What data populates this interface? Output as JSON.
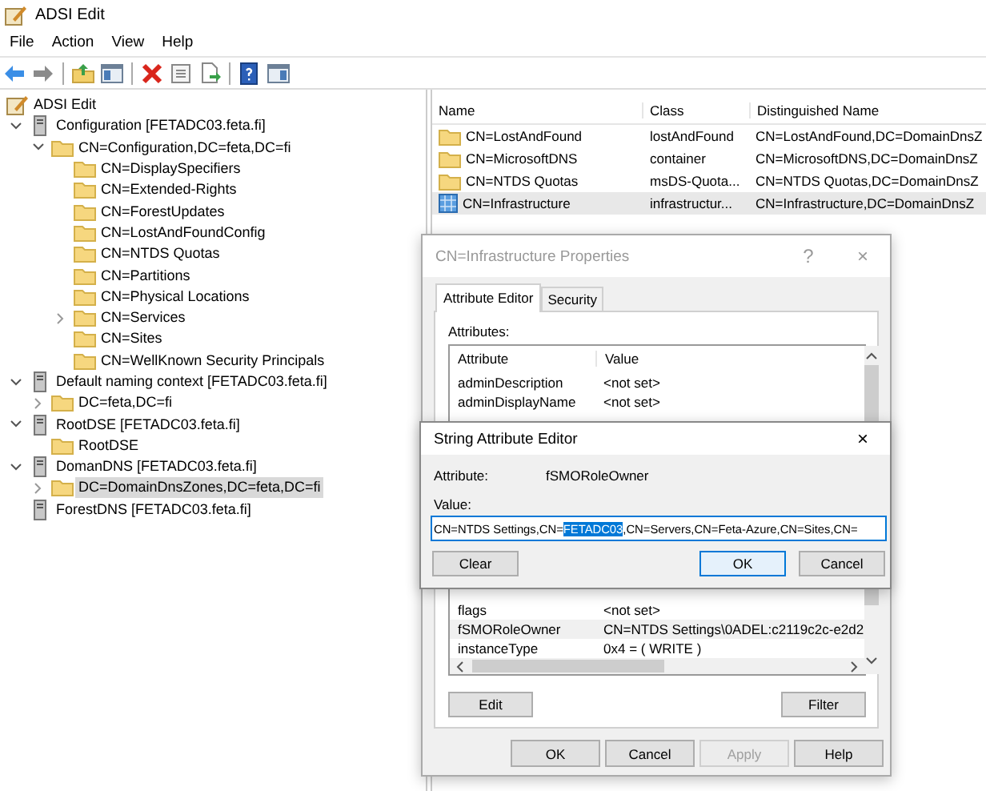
{
  "window": {
    "title": "ADSI Edit"
  },
  "menu": [
    "File",
    "Action",
    "View",
    "Help"
  ],
  "tree": [
    {
      "label": "ADSI Edit",
      "kind": "app",
      "selected": false,
      "children": [
        {
          "label": "Configuration [FETADC03.feta.fi]",
          "kind": "server",
          "expanded": true,
          "selected": false,
          "children": [
            {
              "label": "CN=Configuration,DC=feta,DC=fi",
              "kind": "folder",
              "expanded": true,
              "selected": false,
              "children": [
                {
                  "label": "CN=DisplaySpecifiers",
                  "kind": "folder",
                  "selected": false
                },
                {
                  "label": "CN=Extended-Rights",
                  "kind": "folder",
                  "selected": false
                },
                {
                  "label": "CN=ForestUpdates",
                  "kind": "folder",
                  "selected": false
                },
                {
                  "label": "CN=LostAndFoundConfig",
                  "kind": "folder",
                  "selected": false
                },
                {
                  "label": "CN=NTDS Quotas",
                  "kind": "folder",
                  "selected": false
                },
                {
                  "label": "CN=Partitions",
                  "kind": "folder",
                  "selected": false
                },
                {
                  "label": "CN=Physical Locations",
                  "kind": "folder",
                  "selected": false
                },
                {
                  "label": "CN=Services",
                  "kind": "folder",
                  "expanded": false,
                  "selected": false
                },
                {
                  "label": "CN=Sites",
                  "kind": "folder",
                  "selected": false
                },
                {
                  "label": "CN=WellKnown Security Principals",
                  "kind": "folder",
                  "selected": false
                }
              ]
            }
          ]
        },
        {
          "label": "Default naming context [FETADC03.feta.fi]",
          "kind": "server",
          "expanded": true,
          "selected": false,
          "children": [
            {
              "label": "DC=feta,DC=fi",
              "kind": "folder",
              "expanded": false,
              "selected": false
            }
          ]
        },
        {
          "label": "RootDSE [FETADC03.feta.fi]",
          "kind": "server",
          "expanded": true,
          "selected": false,
          "children": [
            {
              "label": "RootDSE",
              "kind": "folder",
              "selected": false
            }
          ]
        },
        {
          "label": "DomanDNS [FETADC03.feta.fi]",
          "kind": "server",
          "expanded": true,
          "selected": false,
          "children": [
            {
              "label": "DC=DomainDnsZones,DC=feta,DC=fi",
              "kind": "folder",
              "expanded": false,
              "selected": true
            }
          ]
        },
        {
          "label": "ForestDNS [FETADC03.feta.fi]",
          "kind": "server",
          "selected": false
        }
      ]
    }
  ],
  "list": {
    "columns": [
      "Name",
      "Class",
      "Distinguished Name"
    ],
    "rows": [
      {
        "kind": "folder",
        "name": "CN=LostAndFound",
        "class": "lostAndFound",
        "dn": "CN=LostAndFound,DC=DomainDnsZ",
        "selected": false
      },
      {
        "kind": "folder",
        "name": "CN=MicrosoftDNS",
        "class": "container",
        "dn": "CN=MicrosoftDNS,DC=DomainDnsZ",
        "selected": false
      },
      {
        "kind": "folder",
        "name": "CN=NTDS Quotas",
        "class": "msDS-Quota...",
        "dn": "CN=NTDS Quotas,DC=DomainDnsZ",
        "selected": false
      },
      {
        "kind": "object",
        "name": "CN=Infrastructure",
        "class": "infrastructur...",
        "dn": "CN=Infrastructure,DC=DomainDnsZ",
        "selected": true
      }
    ]
  },
  "properties_dialog": {
    "title": "CN=Infrastructure Properties",
    "active": false,
    "help": "?",
    "close": "×",
    "tabs": [
      {
        "label": "Attribute Editor",
        "selected": true
      },
      {
        "label": "Security",
        "selected": false
      }
    ],
    "attributes_label": "Attributes:",
    "columns": [
      "Attribute",
      "Value"
    ],
    "rows_top": [
      {
        "attribute": "adminDescription",
        "value": "<not set>",
        "selected": false
      },
      {
        "attribute": "adminDisplayName",
        "value": "<not set>",
        "selected": false
      }
    ],
    "rows_bottom": [
      {
        "attribute": "flags",
        "value": "<not set>",
        "selected": false
      },
      {
        "attribute": "fSMORoleOwner",
        "value": "CN=NTDS Settings\\0ADEL:c2119c2c-e2d2",
        "selected": true
      },
      {
        "attribute": "instanceType",
        "value": "0x4 = ( WRITE )",
        "selected": false
      }
    ],
    "edit_button": "Edit",
    "filter_button": "Filter",
    "footer_buttons": [
      {
        "label": "OK",
        "disabled": false
      },
      {
        "label": "Cancel",
        "disabled": false
      },
      {
        "label": "Apply",
        "disabled": true
      },
      {
        "label": "Help",
        "disabled": false
      }
    ]
  },
  "string_editor": {
    "title": "String Attribute Editor",
    "active": true,
    "close": "×",
    "attribute_label": "Attribute:",
    "attribute_value": "fSMORoleOwner",
    "value_label": "Value:",
    "value_parts": [
      {
        "text": "CN=NTDS Settings,CN=",
        "selected": false
      },
      {
        "text": "FETADC03",
        "selected": true
      },
      {
        "text": ",CN=Servers,CN=Feta-Azure,CN=Sites,CN=",
        "selected": false
      }
    ],
    "buttons": [
      {
        "label": "Clear",
        "default": false
      },
      {
        "label": "OK",
        "default": true
      },
      {
        "label": "Cancel",
        "default": false
      }
    ]
  }
}
